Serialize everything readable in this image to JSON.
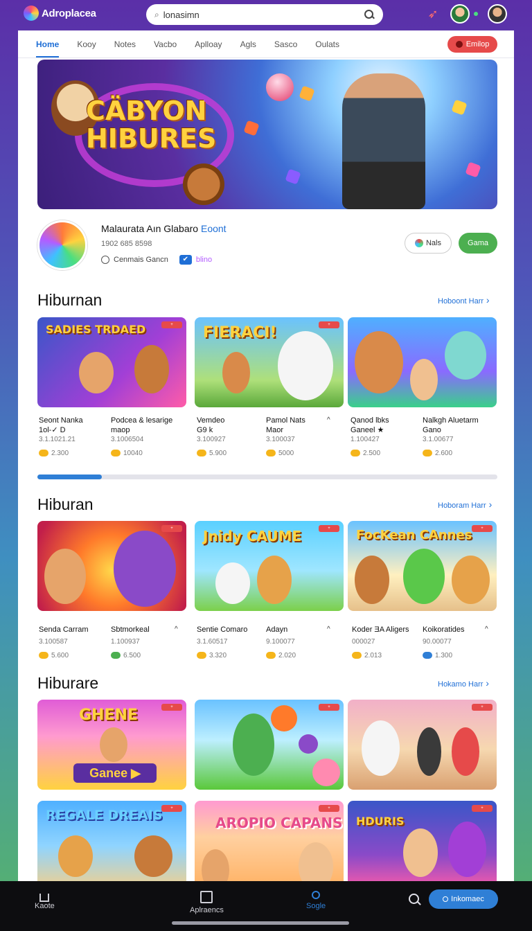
{
  "app": {
    "name": "Adroplacea"
  },
  "search": {
    "value": "lonasimn"
  },
  "nav": {
    "tabs": [
      "Home",
      "Kooy",
      "Notes",
      "Vacbo",
      "Aplloay",
      "Agls",
      "Sasco",
      "Oulats"
    ],
    "signin_label": "Emilop"
  },
  "hero": {
    "title_line1": "CÄBYON",
    "title_line2": "HIBURES"
  },
  "channel": {
    "name": "Malaurata Aın Glabaro",
    "name_tag": "Eoont",
    "stats": "1902 685 8598",
    "meta_label": "Cenmais Gancn",
    "meta_link": "blino",
    "follow_label": "Nals",
    "primary_label": "Gama"
  },
  "sections": [
    {
      "title": "Hiburnan",
      "see_all": "Hoboont Harr",
      "cards": [
        {
          "art": "SADIES TRDAED",
          "title": "Seont Nanka",
          "sub": "1ol-✓ D",
          "id": "3.1.1021.21",
          "count": "2.300"
        },
        {
          "art": "FIERACI!",
          "title": "Podcea & lesarige",
          "sub": "maop",
          "id": "3.1006504",
          "count": "10040"
        },
        {
          "art": "",
          "title": "Vemdeo",
          "sub": "G9 k",
          "id": "3.100927",
          "count": "5.900"
        },
        {
          "art": "",
          "title": "Pamol Nats",
          "sub": "Maor",
          "id": "3.100037",
          "count": "5000"
        },
        {
          "art": "",
          "title": "Qanod lbks",
          "sub": "Ganeel ★",
          "id": "1.100427",
          "count": "2.500"
        },
        {
          "art": "",
          "title": "Nalkgh Aluetarm",
          "sub": "Gano",
          "id": "3.1.00677",
          "count": "2.600"
        }
      ],
      "progress": 0.14
    },
    {
      "title": "Hiburan",
      "see_all": "Hoboram Harr",
      "cards": [
        {
          "art": "",
          "title": "Senda Carram",
          "sub": "",
          "id": "3.100587",
          "count": "5.600"
        },
        {
          "art": "",
          "title": "Sbtmorkeal",
          "sub": "",
          "id": "1.100937",
          "count": "6.500"
        },
        {
          "art": "Jnidy CAUME",
          "title": "Sentie Comaro",
          "sub": "",
          "id": "3.1.60517",
          "count": "3.320"
        },
        {
          "art": "",
          "title": "Adayn",
          "sub": "",
          "id": "9.100077",
          "count": "2.020"
        },
        {
          "art": "FocKean CAnnes",
          "title": "Koder ƎA Aligers",
          "sub": "",
          "id": "000027",
          "count": "2.013"
        },
        {
          "art": "",
          "title": "Koikoratides",
          "sub": "",
          "id": "90.00077",
          "count": "1.300"
        }
      ]
    },
    {
      "title": "Hiburare",
      "see_all": "Hokamo Harr",
      "cards": [
        {
          "art": "GHENE",
          "sub_art": "Ganee"
        },
        {
          "art": ""
        },
        {
          "art": ""
        },
        {
          "art": "REGALE DREAIS"
        },
        {
          "art": "AROPIO CAPANS"
        },
        {
          "art": "HDURIS"
        }
      ]
    }
  ],
  "bottom_nav": {
    "items": [
      "Kaote",
      "Aplraencs",
      "Sogle"
    ],
    "cta_label": "Inkomaec"
  },
  "colors": {
    "accent": "#2f7fd6",
    "danger": "#e64a4a",
    "success": "#4caf50",
    "coin": "#f5b51a"
  }
}
